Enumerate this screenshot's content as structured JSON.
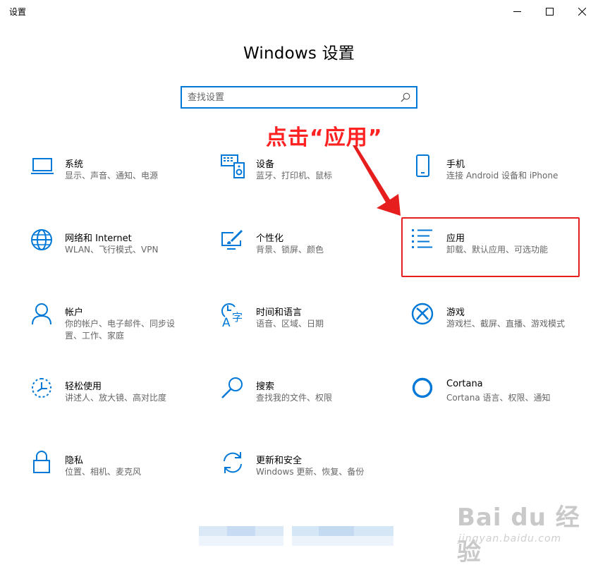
{
  "window": {
    "title": "设置",
    "colors": {
      "accent": "#0078d7",
      "annotation": "#e61e1e"
    }
  },
  "page": {
    "title": "Windows 设置"
  },
  "search": {
    "placeholder": "查找设置",
    "icon": "search-icon"
  },
  "annotation": {
    "text": "点击“应用”"
  },
  "tiles": [
    {
      "name": "系统",
      "desc": "显示、声音、通知、电源",
      "icon": "laptop-icon"
    },
    {
      "name": "设备",
      "desc": "蓝牙、打印机、鼠标",
      "icon": "keyboard-speaker-icon"
    },
    {
      "name": "手机",
      "desc": "连接 Android 设备和 iPhone",
      "icon": "phone-icon"
    },
    {
      "name": "网络和 Internet",
      "desc": "WLAN、飞行模式、VPN",
      "icon": "globe-icon"
    },
    {
      "name": "个性化",
      "desc": "背景、锁屏、颜色",
      "icon": "paint-monitor-icon"
    },
    {
      "name": "应用",
      "desc": "卸载、默认应用、可选功能",
      "icon": "apps-list-icon"
    },
    {
      "name": "帐户",
      "desc": "你的帐户、电子邮件、同步设置、工作、家庭",
      "icon": "person-icon"
    },
    {
      "name": "时间和语言",
      "desc": "语音、区域、日期",
      "icon": "time-language-icon"
    },
    {
      "name": "游戏",
      "desc": "游戏栏、截屏、直播、游戏模式",
      "icon": "xbox-icon"
    },
    {
      "name": "轻松使用",
      "desc": "讲述人、放大镜、高对比度",
      "icon": "ease-of-access-icon"
    },
    {
      "name": "搜索",
      "desc": "查找我的文件、权限",
      "icon": "magnifier-icon"
    },
    {
      "name": "Cortana",
      "desc": "Cortana 语言、权限、通知",
      "icon": "cortana-icon"
    },
    {
      "name": "隐私",
      "desc": "位置、相机、麦克风",
      "icon": "lock-icon"
    },
    {
      "name": "更新和安全",
      "desc": "Windows 更新、恢复、备份",
      "icon": "sync-icon"
    }
  ],
  "watermark": {
    "logo": "Bai du 经验",
    "sub": "jingyan.baidu.com"
  }
}
